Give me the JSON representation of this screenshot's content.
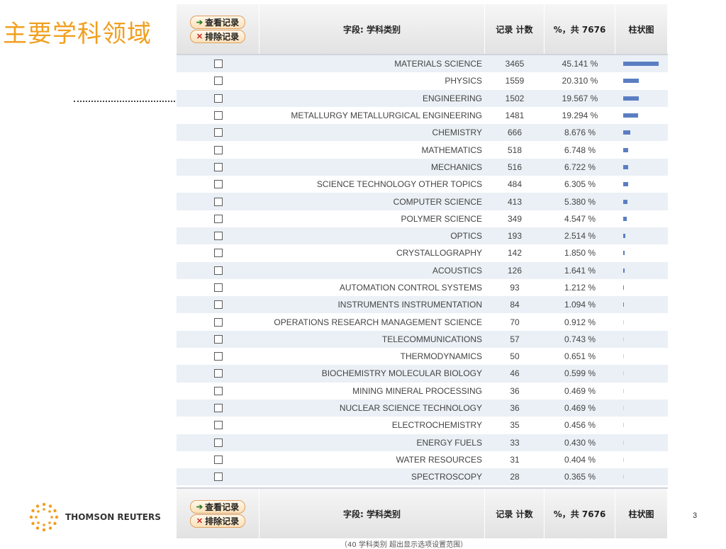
{
  "slide": {
    "title": "主要学科领域",
    "page_number": "3",
    "footnote": "（40 学科类别 超出显示选项设置范围）"
  },
  "logo": {
    "name": "THOMSON REUTERS",
    "icon": "thomson-reuters-logo-icon"
  },
  "table": {
    "buttons": {
      "view": "查看记录",
      "exclude": "排除记录"
    },
    "headers": {
      "field": "字段: 学科类别",
      "count": "记录 计数",
      "percent": "%，共 7676",
      "bar": "柱状图"
    },
    "rows": [
      {
        "name": "MATERIALS SCIENCE",
        "count": "3465",
        "pct": "45.141 %",
        "value": 45.141
      },
      {
        "name": "PHYSICS",
        "count": "1559",
        "pct": "20.310 %",
        "value": 20.31
      },
      {
        "name": "ENGINEERING",
        "count": "1502",
        "pct": "19.567 %",
        "value": 19.567
      },
      {
        "name": "METALLURGY METALLURGICAL ENGINEERING",
        "count": "1481",
        "pct": "19.294 %",
        "value": 19.294
      },
      {
        "name": "CHEMISTRY",
        "count": "666",
        "pct": "8.676 %",
        "value": 8.676
      },
      {
        "name": "MATHEMATICS",
        "count": "518",
        "pct": "6.748 %",
        "value": 6.748
      },
      {
        "name": "MECHANICS",
        "count": "516",
        "pct": "6.722 %",
        "value": 6.722
      },
      {
        "name": "SCIENCE TECHNOLOGY OTHER TOPICS",
        "count": "484",
        "pct": "6.305 %",
        "value": 6.305
      },
      {
        "name": "COMPUTER SCIENCE",
        "count": "413",
        "pct": "5.380 %",
        "value": 5.38
      },
      {
        "name": "POLYMER SCIENCE",
        "count": "349",
        "pct": "4.547 %",
        "value": 4.547
      },
      {
        "name": "OPTICS",
        "count": "193",
        "pct": "2.514 %",
        "value": 2.514
      },
      {
        "name": "CRYSTALLOGRAPHY",
        "count": "142",
        "pct": "1.850 %",
        "value": 1.85
      },
      {
        "name": "ACOUSTICS",
        "count": "126",
        "pct": "1.641 %",
        "value": 1.641
      },
      {
        "name": "AUTOMATION CONTROL SYSTEMS",
        "count": "93",
        "pct": "1.212 %",
        "value": 1.212
      },
      {
        "name": "INSTRUMENTS INSTRUMENTATION",
        "count": "84",
        "pct": "1.094 %",
        "value": 1.094
      },
      {
        "name": "OPERATIONS RESEARCH MANAGEMENT SCIENCE",
        "count": "70",
        "pct": "0.912 %",
        "value": 0.912
      },
      {
        "name": "TELECOMMUNICATIONS",
        "count": "57",
        "pct": "0.743 %",
        "value": 0.743
      },
      {
        "name": "THERMODYNAMICS",
        "count": "50",
        "pct": "0.651 %",
        "value": 0.651
      },
      {
        "name": "BIOCHEMISTRY MOLECULAR BIOLOGY",
        "count": "46",
        "pct": "0.599 %",
        "value": 0.599
      },
      {
        "name": "MINING MINERAL PROCESSING",
        "count": "36",
        "pct": "0.469 %",
        "value": 0.469
      },
      {
        "name": "NUCLEAR SCIENCE TECHNOLOGY",
        "count": "36",
        "pct": "0.469 %",
        "value": 0.469
      },
      {
        "name": "ELECTROCHEMISTRY",
        "count": "35",
        "pct": "0.456 %",
        "value": 0.456
      },
      {
        "name": "ENERGY FUELS",
        "count": "33",
        "pct": "0.430 %",
        "value": 0.43
      },
      {
        "name": "WATER RESOURCES",
        "count": "31",
        "pct": "0.404 %",
        "value": 0.404
      },
      {
        "name": "SPECTROSCOPY",
        "count": "28",
        "pct": "0.365 %",
        "value": 0.365
      }
    ]
  },
  "colors": {
    "title": "#f0a020",
    "bar": "#5b7ec2",
    "alt_row": "#eaf0f5"
  }
}
